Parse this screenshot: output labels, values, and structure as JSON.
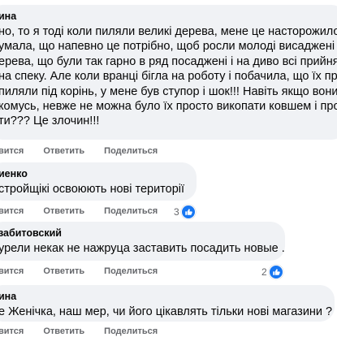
{
  "comments": [
    {
      "author": "ина",
      "lines": [
        "но, то я тоді коли пиляли великі дерева, мене це насторожило і",
        "умала, що напевно це потрібно, щоб росли молоді висаджені н",
        "ерева, що були так гарно в ряд посаджені і на диво всі прийня",
        " на спеку. Але коли вранці бігла на роботу і побачила, що їх пр",
        "пиляли під корінь, у мене був ступор і шок!!! Навіть якщо вони",
        "комусь, невже не можна було їх просто викопати ковшем і про",
        "ти??? Це злочин!!!"
      ],
      "actions": [
        "вится",
        "Ответить",
        "Поделиться"
      ]
    },
    {
      "author": "иенко",
      "lines": [
        "стройщікі освоюють нові території"
      ],
      "actions": [
        "вится",
        "Ответить",
        "Поделиться"
      ],
      "reaction_count": "3"
    },
    {
      "author": "забитовский",
      "lines": [
        "урели некак не нажруца заставить посадить новые ."
      ],
      "actions": [
        "вится",
        "Ответить",
        "Поделиться"
      ],
      "reaction_count": "2"
    },
    {
      "author": "ина",
      "lines": [
        "е Женічка, наш мер, чи його цікавлять тільки нові магазини ?"
      ],
      "actions": [
        "вится",
        "Ответить",
        "Поделиться"
      ]
    }
  ],
  "colors": {
    "bubble": "#f0f2f5",
    "action_text": "#65676b",
    "like_blue": "#1877f2"
  },
  "icons": {
    "reaction": "thumbs-up-icon"
  }
}
